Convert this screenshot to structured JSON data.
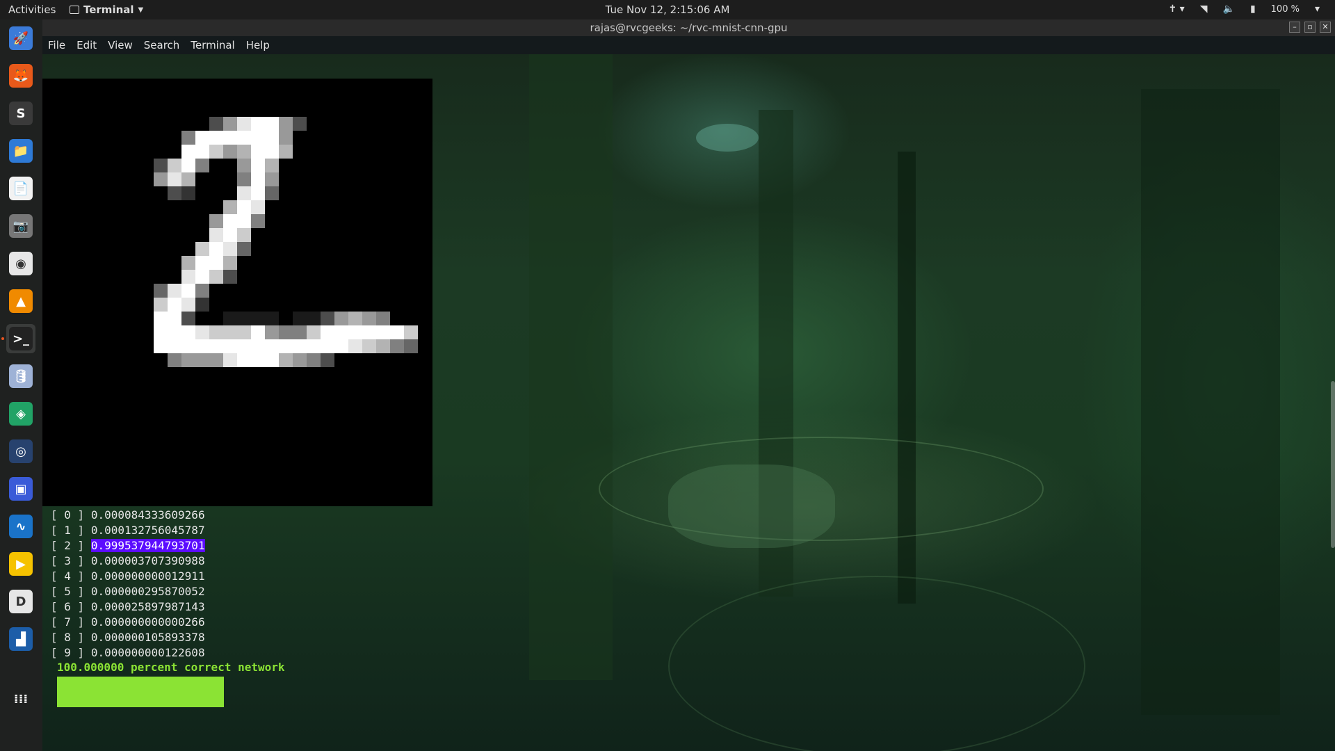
{
  "top_panel": {
    "activities": "Activities",
    "app_name": "Terminal",
    "clock": "Tue Nov 12,  2:15:06 AM",
    "battery": "100 %"
  },
  "dock": {
    "items": [
      {
        "name": "rocket-launcher-icon",
        "glyph": "🚀"
      },
      {
        "name": "firefox-icon",
        "glyph": "🦊"
      },
      {
        "name": "sublime-text-icon",
        "glyph": "S"
      },
      {
        "name": "files-icon",
        "glyph": "📁"
      },
      {
        "name": "text-editor-icon",
        "glyph": "📄"
      },
      {
        "name": "camera-icon",
        "glyph": "📷"
      },
      {
        "name": "chrome-icon",
        "glyph": "◉"
      },
      {
        "name": "vlc-icon",
        "glyph": "▲"
      },
      {
        "name": "terminal-icon",
        "glyph": ">_"
      },
      {
        "name": "database-icon",
        "glyph": "🛢"
      },
      {
        "name": "nvidia-icon",
        "glyph": "◈"
      },
      {
        "name": "settings-disk-icon",
        "glyph": "◎"
      },
      {
        "name": "screen-recorder-icon",
        "glyph": "▣"
      },
      {
        "name": "waveform-icon",
        "glyph": "∿"
      },
      {
        "name": "play-store-icon",
        "glyph": "▶"
      },
      {
        "name": "d-app-icon",
        "glyph": "D"
      },
      {
        "name": "system-monitor-icon",
        "glyph": "▟"
      },
      {
        "name": "show-apps-icon",
        "glyph": "⁞⁞⁞"
      }
    ]
  },
  "terminal": {
    "title": "rajas@rvcgeeks: ~/rvc-mnist-cnn-gpu",
    "menu": [
      "File",
      "Edit",
      "View",
      "Search",
      "Terminal",
      "Help"
    ],
    "predictions": [
      {
        "digit": "[ 0 ]",
        "prob": "0.000084333609266"
      },
      {
        "digit": "[ 1 ]",
        "prob": "0.000132756045787"
      },
      {
        "digit": "[ 2 ]",
        "prob": "0.999537944793701"
      },
      {
        "digit": "[ 3 ]",
        "prob": "0.000003707390988"
      },
      {
        "digit": "[ 4 ]",
        "prob": "0.000000000012911"
      },
      {
        "digit": "[ 5 ]",
        "prob": "0.000000295870052"
      },
      {
        "digit": "[ 6 ]",
        "prob": "0.000025897987143"
      },
      {
        "digit": "[ 7 ]",
        "prob": "0.000000000000266"
      },
      {
        "digit": "[ 8 ]",
        "prob": "0.000000105893378"
      },
      {
        "digit": "[ 9 ]",
        "prob": "0.000000000122608"
      }
    ],
    "selected_index": 2,
    "status": "100.000000 percent correct network",
    "progress_fraction": 1.0
  },
  "colors": {
    "selection": "#5b0cff",
    "status_green": "#8be334",
    "accent": "#e95420"
  }
}
